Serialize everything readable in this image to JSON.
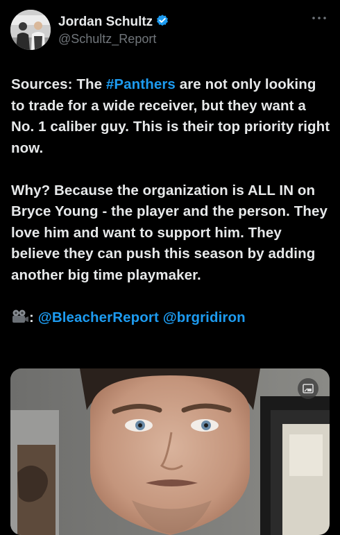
{
  "author": {
    "display_name": "Jordan Schultz",
    "handle": "@Schultz_Report",
    "verified": true,
    "avatar_icon": "avatar-photo"
  },
  "menu_icon": "more-options-icon",
  "tweet": {
    "p1_a": "Sources: The ",
    "p1_hashtag": "#Panthers",
    "p1_b": " are not only looking to trade for a wide receiver, but they want a No. 1 caliber guy. This is their top priority right now.",
    "p2": "Why? Because the organization is ALL IN on Bryce Young - the player and the person. They love him and want to support him. They believe they can push this season by adding another big time playmaker.",
    "p3_emoji": "video-camera-emoji",
    "p3_colon": ": ",
    "mention1": "@BleacherReport",
    "mention_sep": " ",
    "mention2": "@brgridiron"
  },
  "media": {
    "type": "video",
    "overlay_icon": "picture-in-picture-icon"
  },
  "colors": {
    "background": "#000000",
    "text": "#e7e9ea",
    "secondary_text": "#71767b",
    "link": "#1d9bf0",
    "verified_badge": "#1d9bf0"
  }
}
